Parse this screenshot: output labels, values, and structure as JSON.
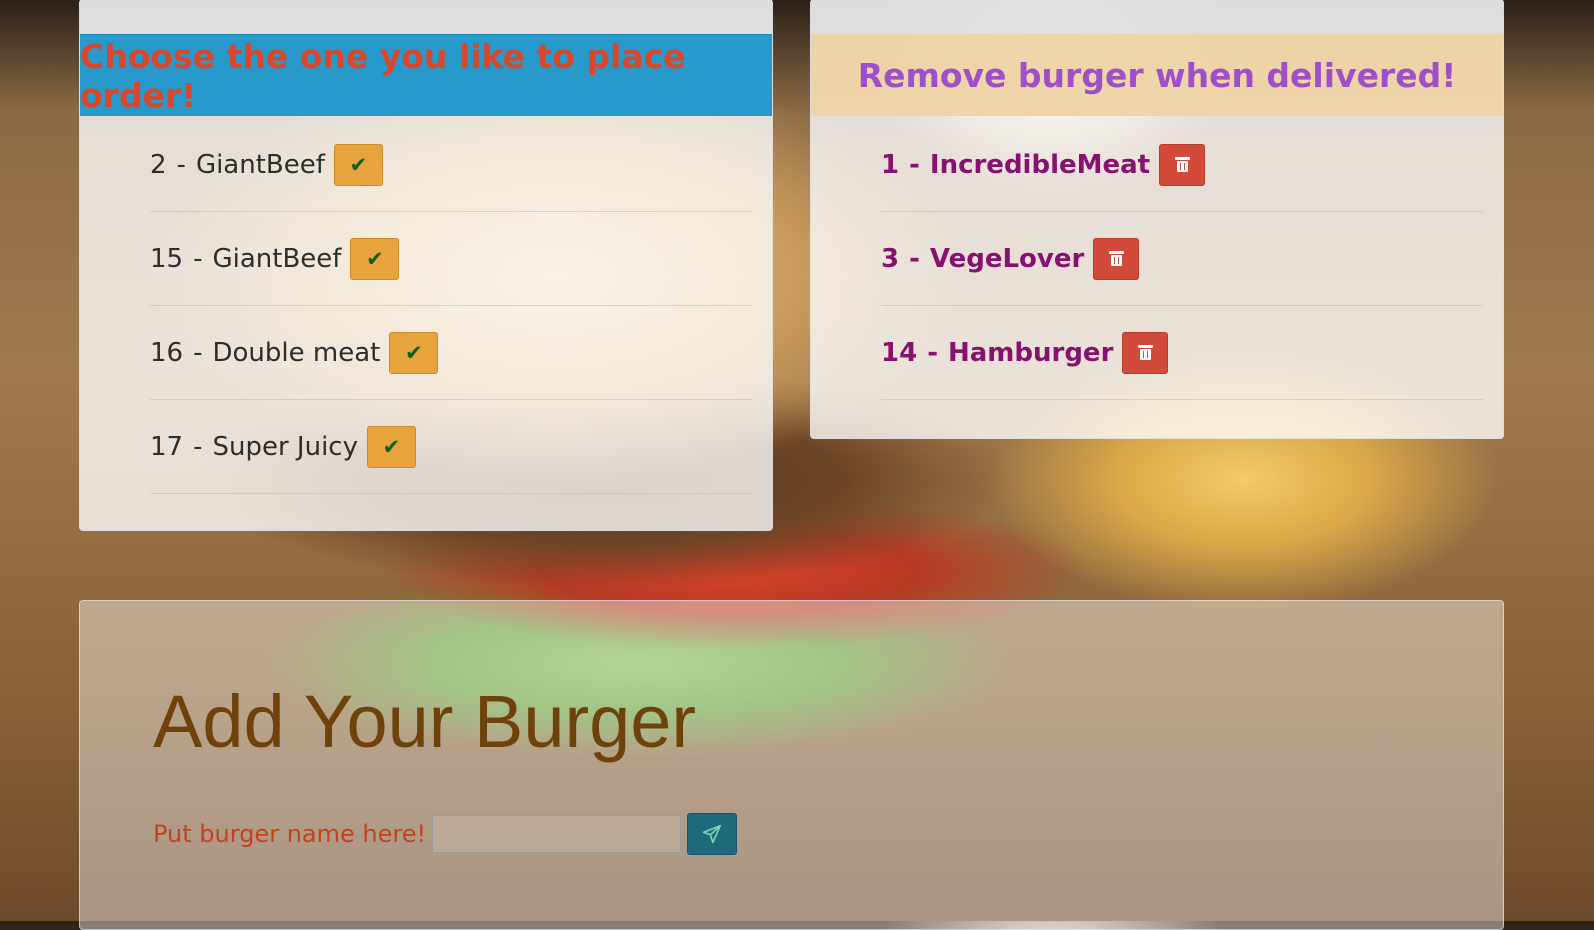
{
  "order_panel": {
    "title": "Choose the one you like to place order!",
    "items": [
      {
        "id": "2",
        "name": "GiantBeef"
      },
      {
        "id": "15",
        "name": "GiantBeef"
      },
      {
        "id": "16",
        "name": "Double meat"
      },
      {
        "id": "17",
        "name": "Super Juicy"
      }
    ],
    "action_icon": "check-icon",
    "button_color": "#e8a43c"
  },
  "delivered_panel": {
    "title": "Remove burger when delivered!",
    "items": [
      {
        "id": "1",
        "name": "IncredibleMeat"
      },
      {
        "id": "3",
        "name": "VegeLover"
      },
      {
        "id": "14",
        "name": "Hamburger"
      }
    ],
    "action_icon": "trash-icon",
    "button_color": "#d24a39"
  },
  "add_panel": {
    "title": "Add Your Burger",
    "label": "Put burger name here!",
    "input_value": "",
    "submit_icon": "paper-plane-icon"
  },
  "separator": "-"
}
